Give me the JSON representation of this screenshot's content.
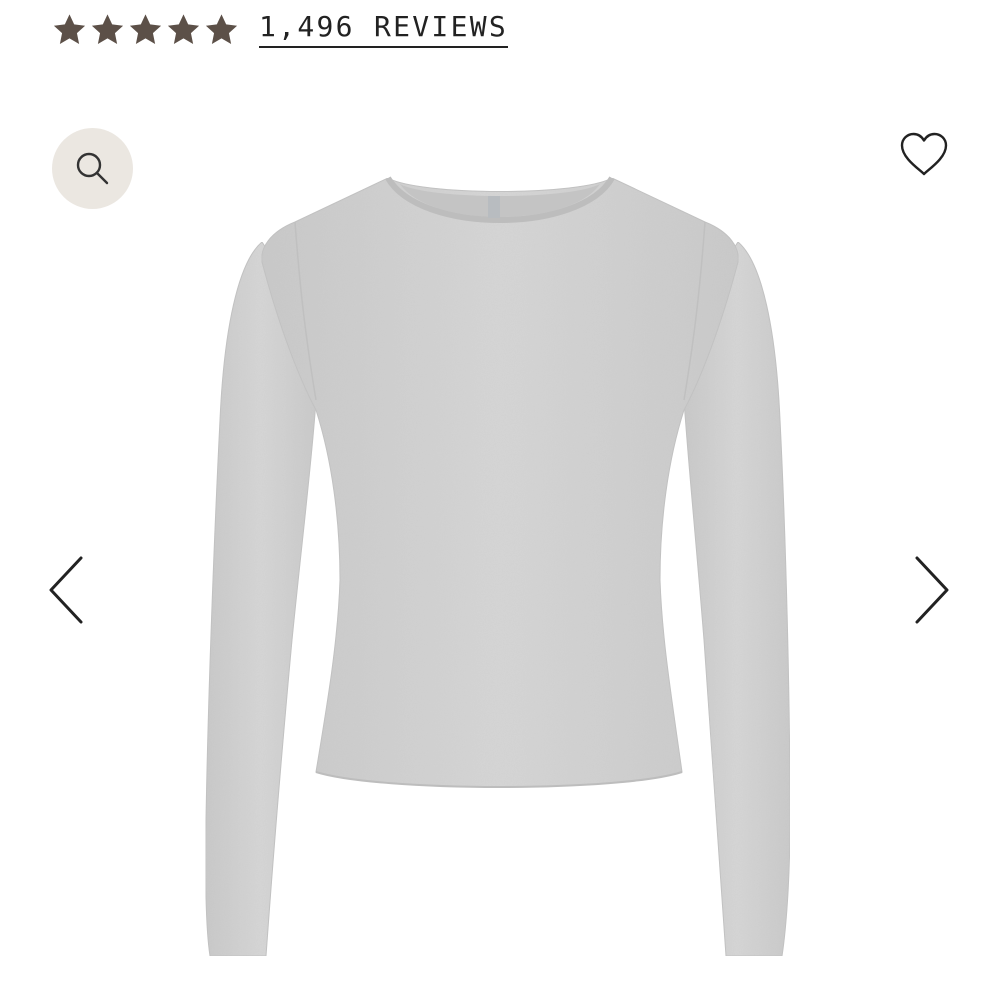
{
  "rating": {
    "stars": 5,
    "star_color": "#5c5048",
    "reviews_label": "1,496 REVIEWS"
  },
  "gallery": {
    "zoom_icon": "search-icon",
    "wishlist_icon": "heart-outline-icon",
    "prev_icon": "chevron-left-icon",
    "next_icon": "chevron-right-icon",
    "product_color": "#d3d3d3",
    "zoom_bg": "#ebe7e1"
  }
}
